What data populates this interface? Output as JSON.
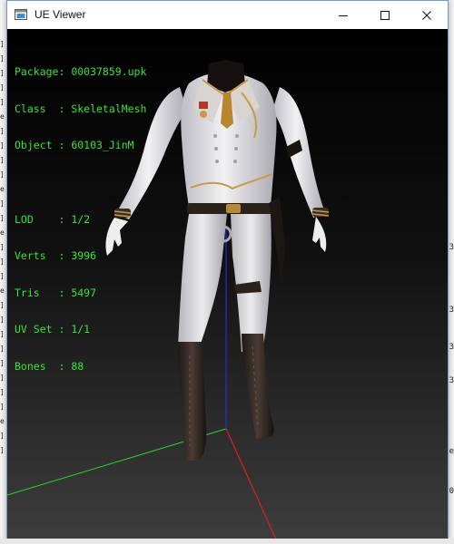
{
  "window": {
    "title": "UE Viewer",
    "controls": {
      "minimize": "minimize",
      "maximize": "maximize",
      "close": "close"
    }
  },
  "info": {
    "package_label": "Package: ",
    "package": "00037859.upk",
    "class_label": "Class  : ",
    "class": "SkeletalMesh",
    "object_label": "Object : ",
    "object": "60103_JinM",
    "lod_label": "LOD    : ",
    "lod": "1/2",
    "verts_label": "Verts  : ",
    "verts": "3996",
    "tris_label": "Tris   : ",
    "tris": "5497",
    "uvset_label": "UV Set : ",
    "uvset": "1/1",
    "bones_label": "Bones  : ",
    "bones": "88"
  },
  "colors": {
    "overlay_text": "#33e633",
    "x_axis": "#e01f1f",
    "y_axis": "#22dd22",
    "z_axis": "#2a2aff",
    "uniform": "#e9e9ec",
    "gold_trim": "#b98a36",
    "boots": "#2a2320"
  },
  "background": {
    "left_marks": [
      "]",
      "]",
      "]",
      "]",
      "]",
      "e",
      "]",
      "]",
      "]",
      "]",
      "e",
      "]",
      "]",
      "e",
      "]",
      "]",
      "]",
      "e",
      "]",
      "]",
      "]",
      "]",
      "]",
      "]",
      "]",
      "]",
      "e",
      "]",
      "]"
    ],
    "right_marks": [
      "3",
      "3",
      "3",
      "3",
      "e",
      "0"
    ]
  }
}
